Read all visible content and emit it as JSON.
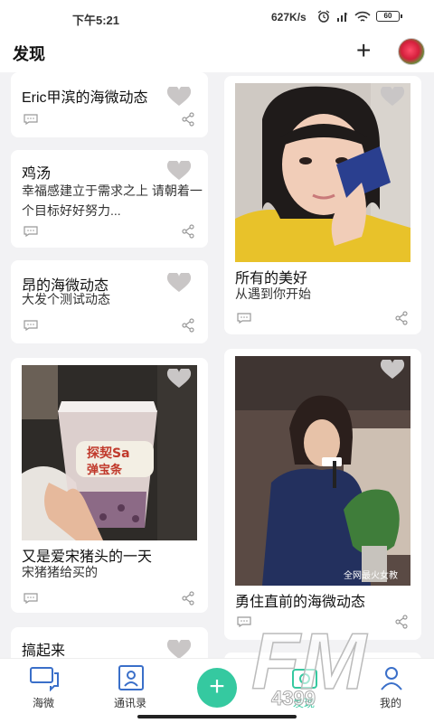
{
  "status": {
    "time": "下午5:21",
    "speed": "627K/s",
    "battery": "60"
  },
  "header": {
    "title": "发现",
    "plus": "+"
  },
  "left_cards": [
    {
      "title": "Eric甲滨的海微动态"
    },
    {
      "title": "鸡汤",
      "desc": "幸福感建立于需求之上 请朝着一个目标好好努力..."
    },
    {
      "title": "昂的海微动态",
      "desc": "大发个测试动态"
    },
    {
      "title": "又是爱宋猪头的一天",
      "desc": "宋猪猪给买的"
    },
    {
      "title": "搞起来"
    }
  ],
  "right_cards": [
    {
      "title": "所有的美好",
      "desc": "从遇到你开始"
    },
    {
      "title": "勇住直前的海微动态"
    }
  ],
  "photo_text": {
    "cup_brand_1": "探契Sa",
    "cup_brand_2": "弹宝条",
    "video_caption": "全网最火女教"
  },
  "tabs": [
    {
      "label": "海微",
      "icon": "chat-icon"
    },
    {
      "label": "通讯录",
      "icon": "contacts-icon"
    },
    {
      "label": "发现",
      "icon": "discover-icon"
    },
    {
      "label": "我的",
      "icon": "profile-icon"
    }
  ],
  "fab": "+",
  "watermark": {
    "big": "FM",
    "small": "4399"
  },
  "colors": {
    "accent": "#35c9a0",
    "heart": "#c9c6c6",
    "background": "#f2f2f4"
  }
}
